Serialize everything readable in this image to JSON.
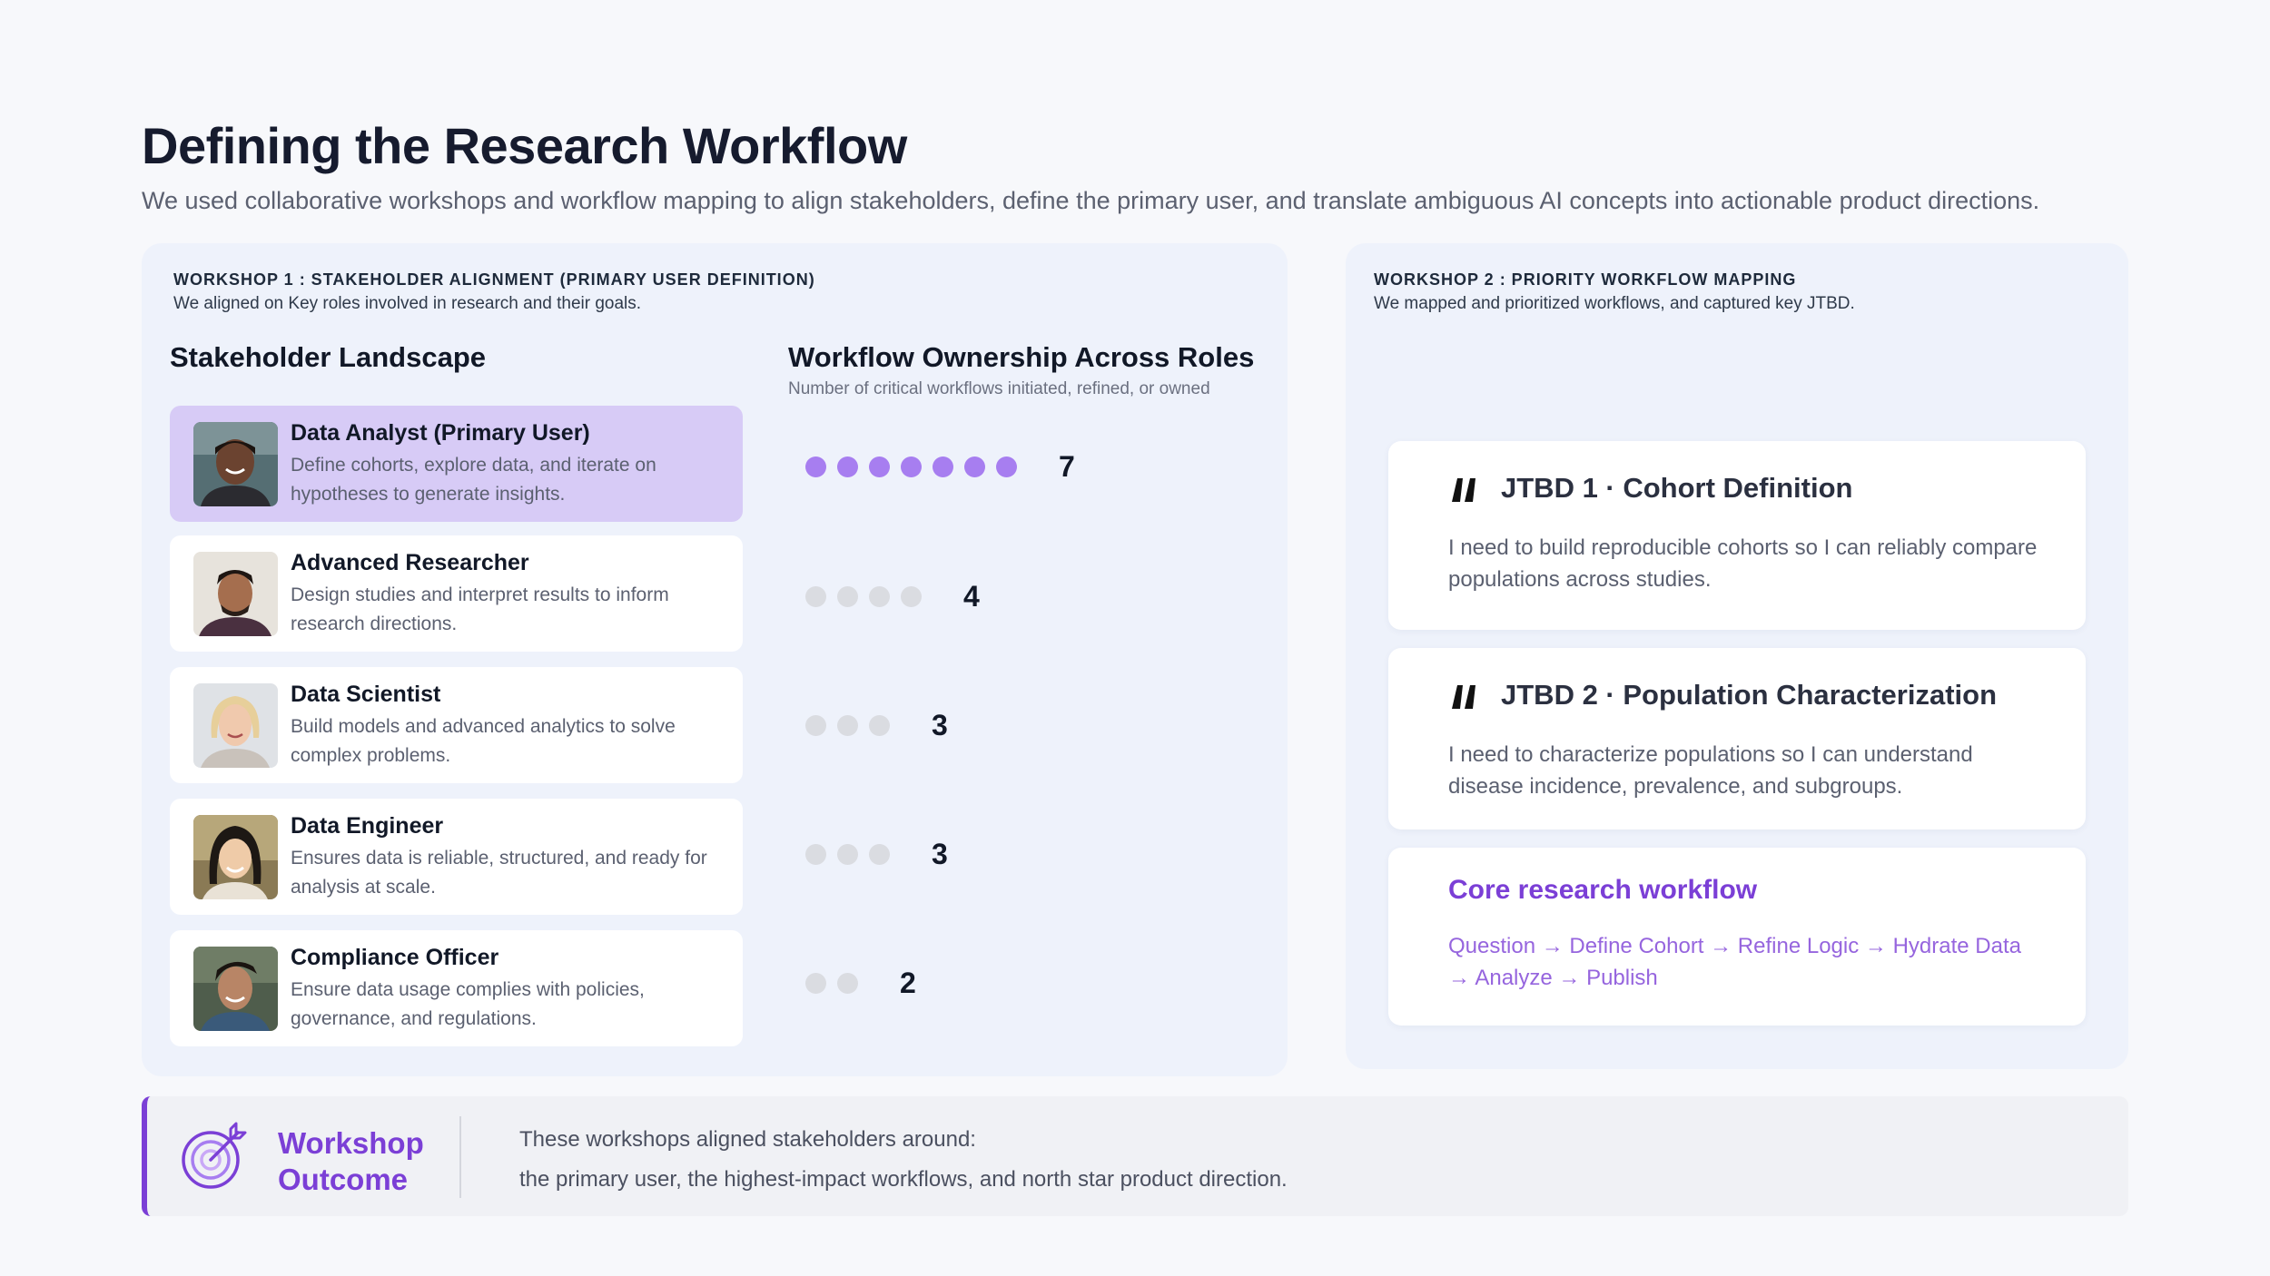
{
  "header": {
    "title": "Defining the Research Workflow",
    "subtitle": "We used collaborative workshops and workflow mapping to align stakeholders, define the primary user, and translate ambiguous AI concepts into actionable product directions."
  },
  "workshop1": {
    "title": "WORKSHOP 1 : STAKEHOLDER ALIGNMENT (PRIMARY USER DEFINITION)",
    "description": "We aligned on Key roles involved in research and their goals.",
    "landscape_heading": "Stakeholder Landscape",
    "ownership_heading": "Workflow Ownership Across Roles",
    "ownership_sub": "Number of critical workflows initiated, refined, or owned",
    "stakeholders": [
      {
        "name": "Data Analyst (Primary User)",
        "description": "Define cohorts, explore data, and iterate on hypotheses to generate insights.",
        "workflows": 7,
        "count_label": "7",
        "primary": true
      },
      {
        "name": "Advanced Researcher",
        "description": "Design studies and interpret results to inform research directions.",
        "workflows": 4,
        "count_label": "4",
        "primary": false
      },
      {
        "name": "Data Scientist",
        "description": "Build models and advanced analytics to solve complex problems.",
        "workflows": 3,
        "count_label": "3",
        "primary": false
      },
      {
        "name": "Data Engineer",
        "description": "Ensures data is reliable, structured, and ready for analysis at scale.",
        "workflows": 3,
        "count_label": "3",
        "primary": false
      },
      {
        "name": "Compliance Officer",
        "description": "Ensure data usage complies with policies, governance, and regulations.",
        "workflows": 2,
        "count_label": "2",
        "primary": false
      }
    ],
    "colors": {
      "primary_card": "#d7cbf6",
      "dot_active": "#a77ef0",
      "dot_inactive": "#dadce1"
    }
  },
  "workshop2": {
    "title": "WORKSHOP 2 : PRIORITY WORKFLOW MAPPING",
    "description": "We mapped and prioritized workflows, and captured key JTBD.",
    "jtbd": [
      {
        "title": "JTBD 1 · Cohort Definition",
        "text": "I need to build reproducible cohorts so I can reliably compare populations across studies.",
        "icon": "quote-icon"
      },
      {
        "title": "JTBD 2 · Population Characterization",
        "text": "I need to characterize populations so I can understand disease incidence, prevalence, and subgroups.",
        "icon": "quote-icon"
      }
    ],
    "core": {
      "title": "Core research workflow",
      "flow": "Question → Define Cohort → Refine Logic → Hydrate Data → Analyze → Publish"
    }
  },
  "outcome": {
    "title_line1": "Workshop",
    "title_line2": "Outcome",
    "icon": "target-icon",
    "line1": "These workshops aligned stakeholders around:",
    "line2": "the primary user, the highest-impact workflows, and north star product direction.",
    "accent": "#7b3fd6"
  }
}
